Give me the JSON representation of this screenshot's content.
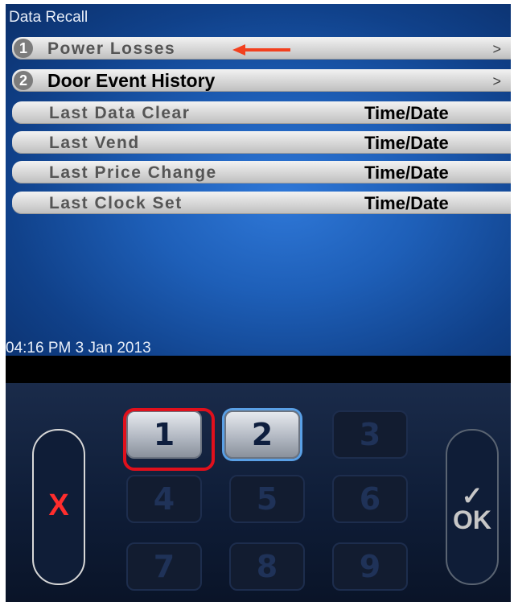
{
  "screen": {
    "title": "Data Recall",
    "timestamp": "04:16 PM 3 Jan 2013"
  },
  "menu": {
    "items": [
      {
        "number": "1",
        "label": "Power Losses",
        "chevron": ">"
      },
      {
        "number": "2",
        "label": "Door Event History",
        "chevron": ">"
      }
    ],
    "info_rows": [
      {
        "label": "Last Data Clear",
        "value": "Time/Date"
      },
      {
        "label": "Last Vend",
        "value": "Time/Date"
      },
      {
        "label": "Last Price Change",
        "value": "Time/Date"
      },
      {
        "label": "Last Clock Set",
        "value": "Time/Date"
      }
    ]
  },
  "keypad": {
    "keys": [
      "1",
      "2",
      "3",
      "4",
      "5",
      "6",
      "7",
      "8",
      "9"
    ],
    "cancel_label": "X",
    "ok_check": "✓",
    "ok_label": "OK"
  },
  "colors": {
    "highlight": "#e0101c",
    "arrow": "#f2401e",
    "cancel": "#ff2d2d"
  }
}
